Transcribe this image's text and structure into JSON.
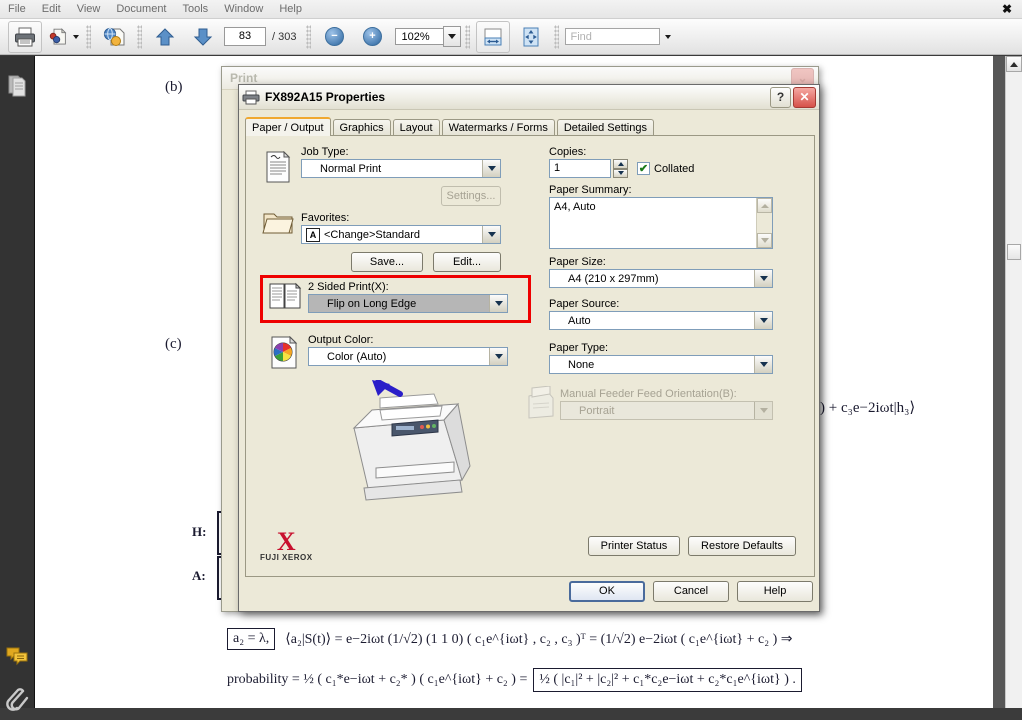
{
  "app": {
    "menu": [
      "File",
      "Edit",
      "View",
      "Document",
      "Tools",
      "Window",
      "Help"
    ],
    "close_glyph": "✖",
    "toolbar": {
      "print_icon": "printer-icon",
      "snapshot_icon": "snapshot-icon",
      "web_icon": "web-capture-icon",
      "prev_icon": "previous-page-icon",
      "next_icon": "next-page-icon",
      "page_current": "83",
      "page_total": "/ 303",
      "zoom_out": "−",
      "zoom_in": "+",
      "zoom_value": "102%",
      "fit_width_icon": "fit-width-icon",
      "fit_page_icon": "fit-page-icon",
      "find_placeholder": "Find"
    },
    "sidebar": {
      "pages_icon": "pages-panel-icon",
      "comments_icon": "comments-panel-icon",
      "attachments_icon": "attachments-panel-icon"
    }
  },
  "document": {
    "labels": {
      "b": "(b)",
      "c": "(c)",
      "h": "H:",
      "a": "A:"
    },
    "fragment_right": ") + c₃e−2iωt|h₃⟩",
    "formula_boxed": "a₂ = λ,",
    "formula_line1": "⟨a₂|S(t)⟩ = e−2iωt (1/√2) (1 1 0) ( c₁e^{iωt} , c₂ , c₃ )ᵀ = (1/√2) e−2iωt ( c₁e^{iωt} + c₂ ) ⇒",
    "formula_line2_left": "probability = ½ ( c₁*e−iωt + c₂* ) ( c₁e^{iωt} + c₂ ) =",
    "formula_line2_boxed": "½ ( |c₁|² + |c₂|² + c₁*c₂e−iωt + c₂*c₁e^{iωt} ) ."
  },
  "print_dialog": {
    "title": "Print",
    "close_glyph": "⌄"
  },
  "properties_dialog": {
    "title": "FX892A15 Properties",
    "printer_icon": "printer-icon",
    "help_button": "?",
    "close_button": "✕",
    "tabs": [
      {
        "label": "Paper / Output",
        "selected": true
      },
      {
        "label": "Graphics",
        "selected": false
      },
      {
        "label": "Layout",
        "selected": false
      },
      {
        "label": "Watermarks / Forms",
        "selected": false
      },
      {
        "label": "Detailed Settings",
        "selected": false
      }
    ],
    "left": {
      "job_type_label": "Job Type:",
      "job_type_value": "Normal Print",
      "job_type_icon": "document-job-icon",
      "settings_button": "Settings...",
      "favorites_label": "Favorites:",
      "favorites_value": "<Change>Standard",
      "favorites_badge": "A",
      "favorites_icon": "folder-icon",
      "save_button": "Save...",
      "edit_button": "Edit...",
      "two_sided_label": "2 Sided Print(X):",
      "two_sided_value": "Flip on Long Edge",
      "two_sided_icon": "two-sided-print-icon",
      "output_color_label": "Output Color:",
      "output_color_value": "Color (Auto)",
      "output_color_icon": "color-wheel-icon"
    },
    "right": {
      "copies_label": "Copies:",
      "copies_value": "1",
      "collated_label": "Collated",
      "collated_checked": true,
      "paper_summary_label": "Paper Summary:",
      "paper_summary_value": "A4, Auto",
      "paper_size_label": "Paper Size:",
      "paper_size_value": "A4 (210 x 297mm)",
      "paper_source_label": "Paper Source:",
      "paper_source_value": "Auto",
      "paper_type_label": "Paper Type:",
      "paper_type_value": "None",
      "manual_feeder_label": "Manual Feeder Feed Orientation(B):",
      "manual_feeder_value": "Portrait",
      "manual_feeder_icon": "manual-feeder-icon"
    },
    "brand": {
      "mark": "X",
      "name": "FUJI XEROX",
      "printer_preview_icon": "printer-preview-icon"
    },
    "secondary_buttons": [
      "Printer Status",
      "Restore Defaults"
    ],
    "footer_buttons": [
      "OK",
      "Cancel",
      "Help"
    ],
    "highlight_color": "#ee0000"
  }
}
